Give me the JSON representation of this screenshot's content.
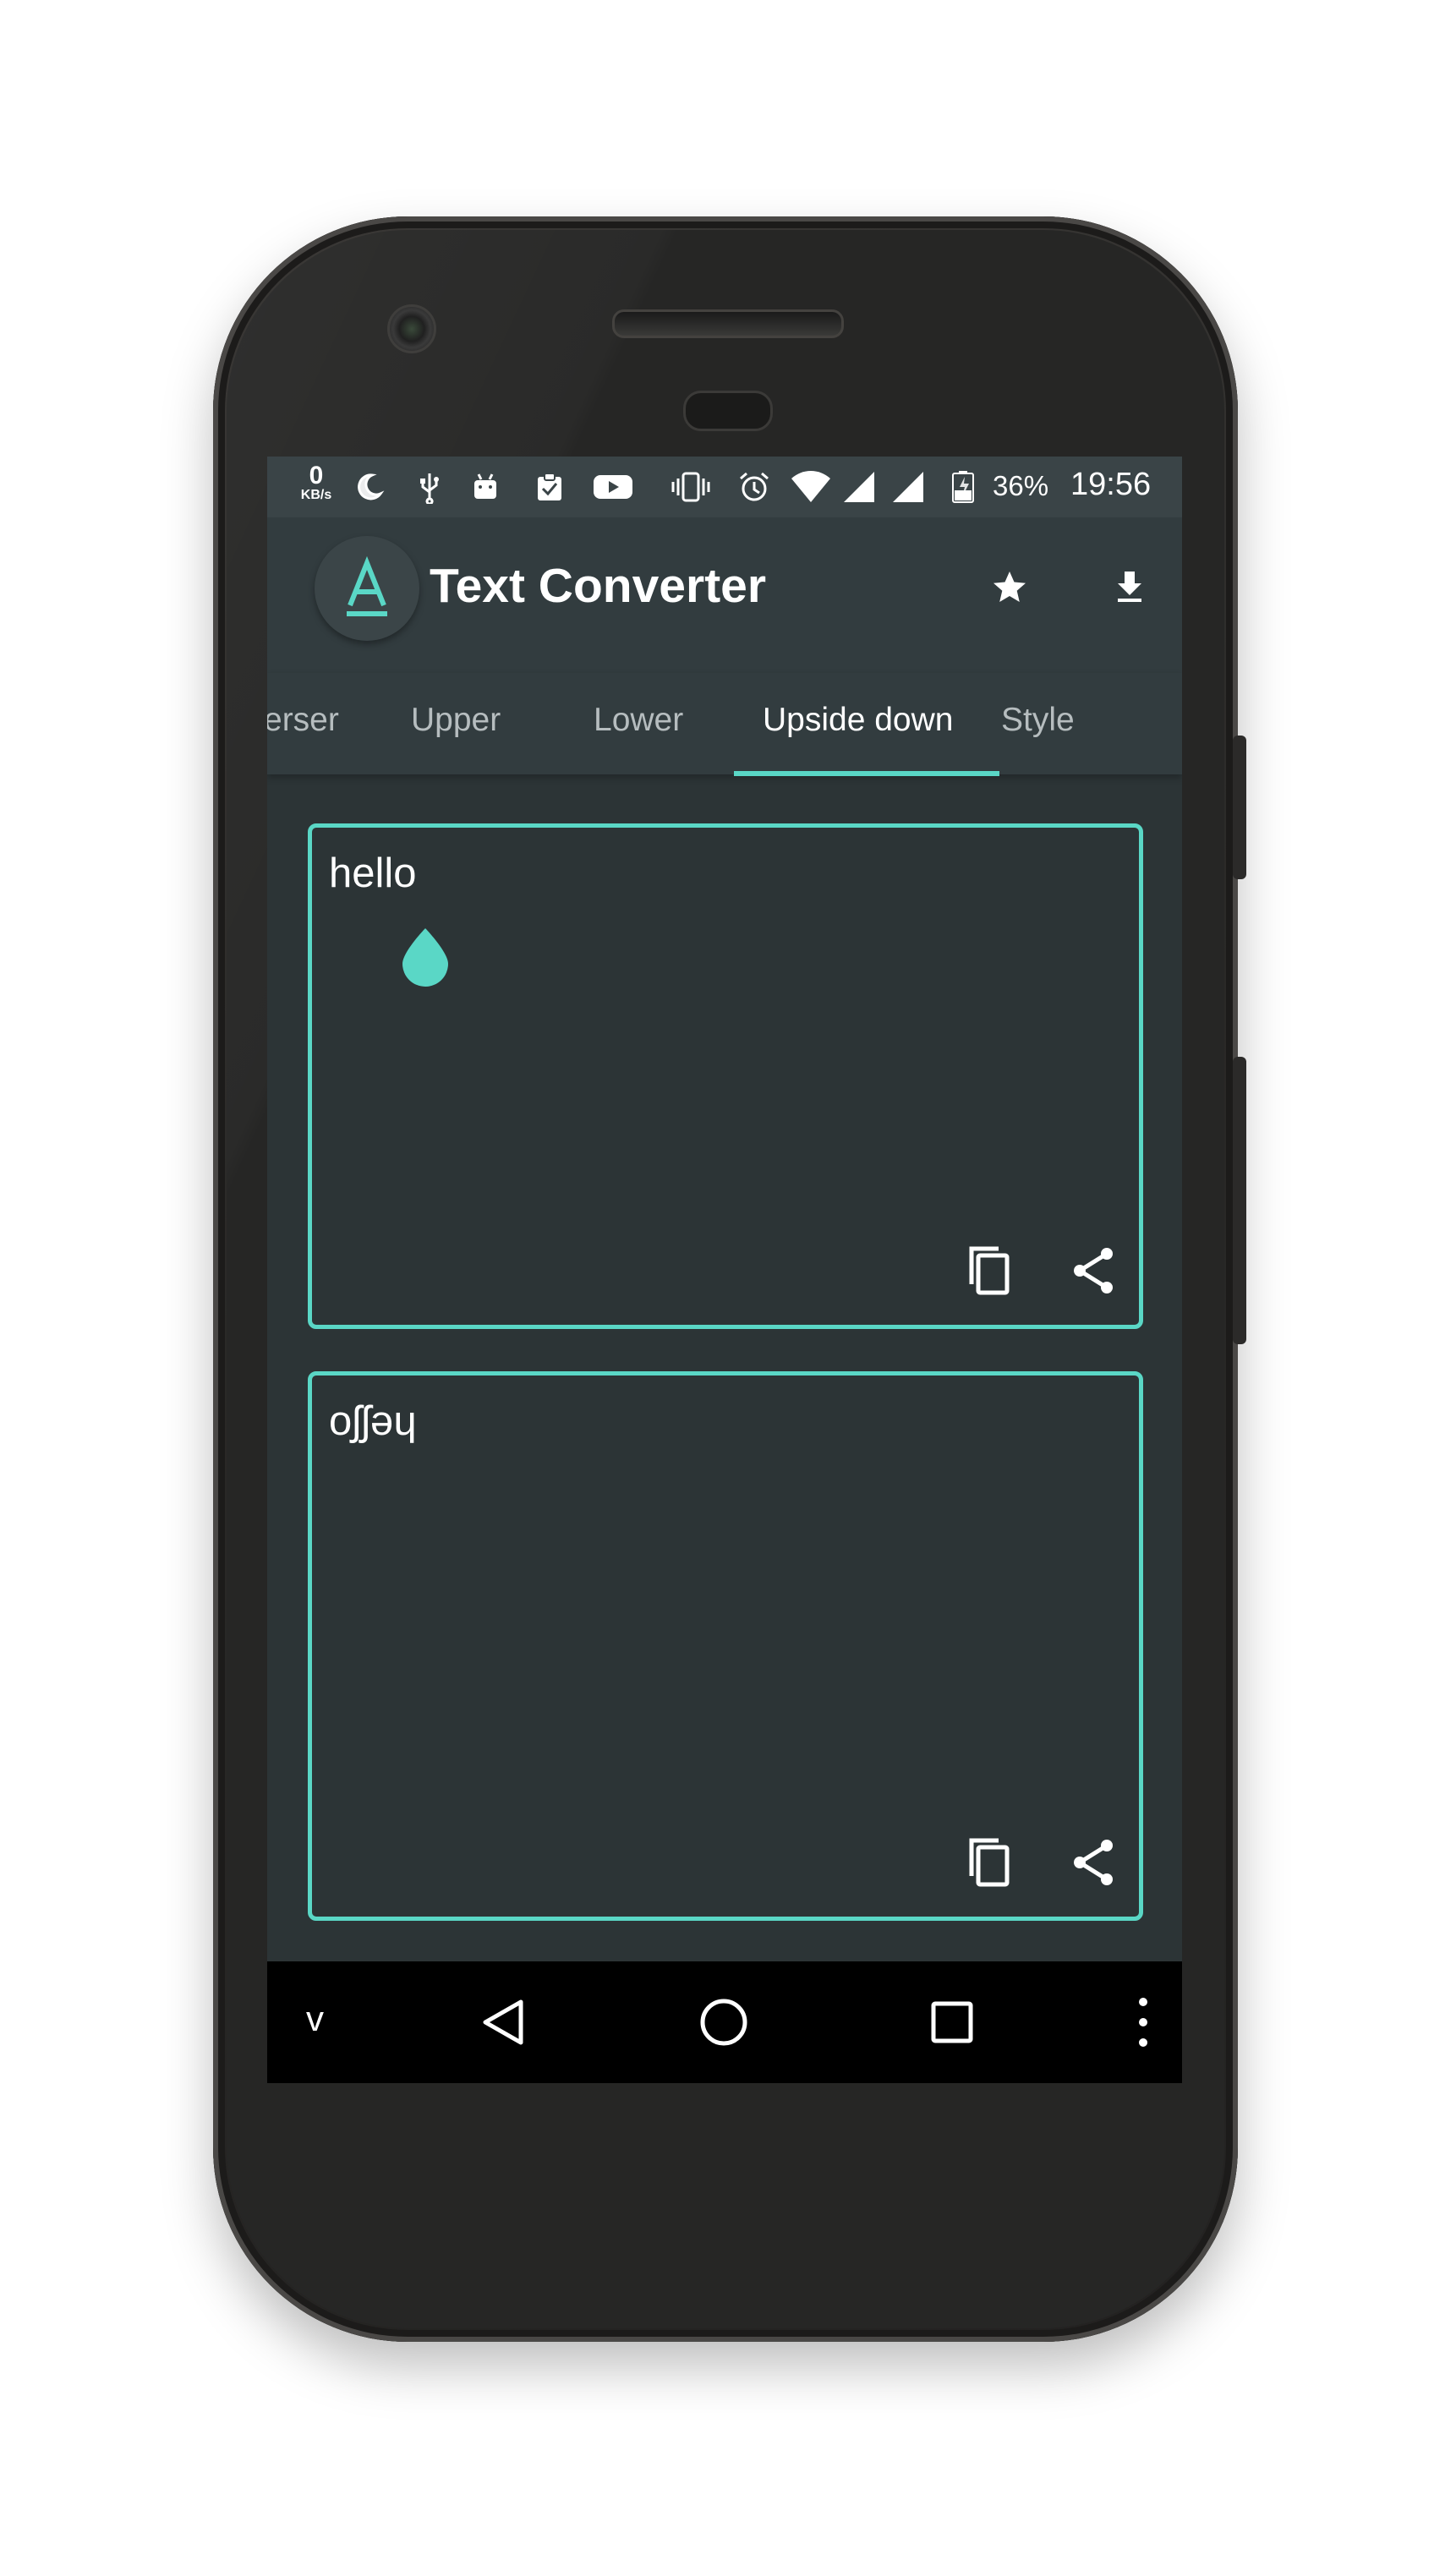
{
  "status_bar": {
    "net_speed_value": "0",
    "net_speed_unit": "KB/s",
    "battery": "36%",
    "time": "19:56",
    "icons": [
      "moon-icon",
      "usb-icon",
      "android-icon",
      "clipboard-icon",
      "youtube-icon",
      "vibrate-icon",
      "alarm-icon",
      "wifi-icon",
      "signal-icon",
      "signal-icon-2",
      "battery-icon"
    ]
  },
  "app_bar": {
    "title": "Text Converter",
    "logo_icon": "letter-a-logo",
    "actions": [
      "star-icon",
      "download-icon"
    ]
  },
  "tabs": [
    {
      "label": "Reverser",
      "visible_text": "erser"
    },
    {
      "label": "Upper"
    },
    {
      "label": "Lower"
    },
    {
      "label": "Upside down"
    },
    {
      "label": "Style"
    }
  ],
  "active_tab": "Upside down",
  "input_card": {
    "text": "hello",
    "actions": [
      "copy-icon",
      "share-icon"
    ]
  },
  "output_card": {
    "text": "oʃʃǝɥ",
    "actions": [
      "copy-icon",
      "share-icon"
    ]
  },
  "nav_bar": {
    "items": [
      "chevron-down-icon",
      "back-icon",
      "home-icon",
      "recents-icon",
      "more-vert-icon"
    ],
    "down_label": "v"
  },
  "colors": {
    "accent": "#5ad7c6",
    "background": "#2c3436",
    "appbar": "#323c3f",
    "statusbar": "#3a4447"
  }
}
